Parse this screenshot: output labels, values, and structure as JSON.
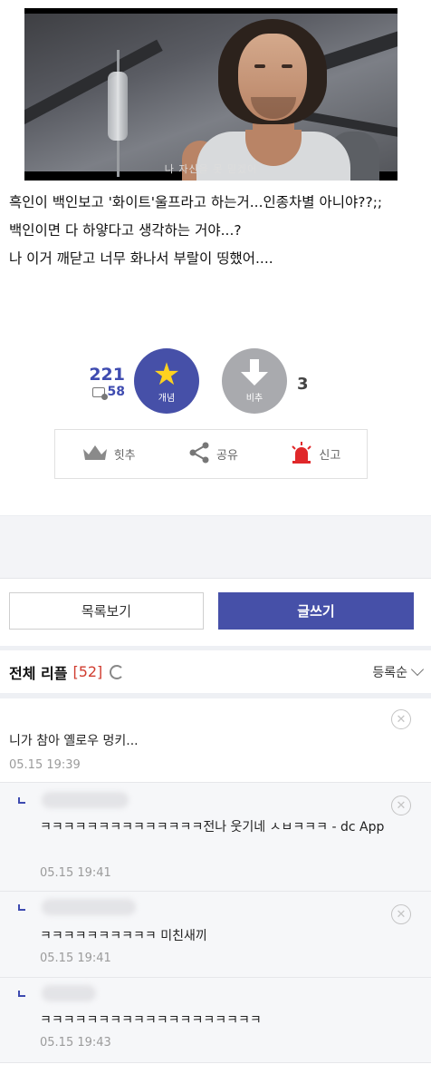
{
  "video": {
    "subtitle": "나 자신을 못 믿겠어"
  },
  "post": {
    "lines": [
      "흑인이 백인보고 '화이트'울프라고 하는거...인종차별 아니야??;;",
      "백인이면 다 하얗다고 생각하는 거야...?",
      "나 이거 깨닫고 너무 화나서 부랄이 띵했어...."
    ]
  },
  "votes": {
    "up_count": "221",
    "fixed_count": "58",
    "up_label": "개념",
    "down_label": "비추",
    "down_count": "3"
  },
  "actions": {
    "hit": "힛추",
    "share": "공유",
    "report": "신고"
  },
  "buttons": {
    "list": "목록보기",
    "write": "글쓰기"
  },
  "comments_header": {
    "title": "전체 리플",
    "count": "[52]",
    "sort": "등록순"
  },
  "comments": [
    {
      "text": "니가 참아 옐로우 멍키...",
      "date": "05.15 19:39"
    },
    {
      "text": "ㅋㅋㅋㅋㅋㅋㅋㅋㅋㅋㅋㅋㅋㅋ전나 웃기네 ㅅㅂㅋㅋㅋ - dc App",
      "date": "05.15 19:41"
    },
    {
      "text": "ㅋㅋㅋㅋㅋㅋㅋㅋㅋㅋ 미친새끼",
      "date": "05.15 19:41"
    },
    {
      "text": "ㅋㅋㅋㅋㅋㅋㅋㅋㅋㅋㅋㅋㅋㅋㅋㅋㅋㅋㅋ",
      "date": "05.15 19:43"
    }
  ],
  "colors": {
    "accent": "#4650a8",
    "count_red": "#d03c2f",
    "star": "#ffd21f",
    "downvote": "#a9aaae",
    "siren": "#e0282a"
  },
  "icons": [
    "star-icon",
    "arrow-down-icon",
    "crown-icon",
    "share-icon",
    "siren-icon",
    "refresh-icon",
    "chevron-down-icon",
    "close-icon",
    "reply-icon"
  ]
}
